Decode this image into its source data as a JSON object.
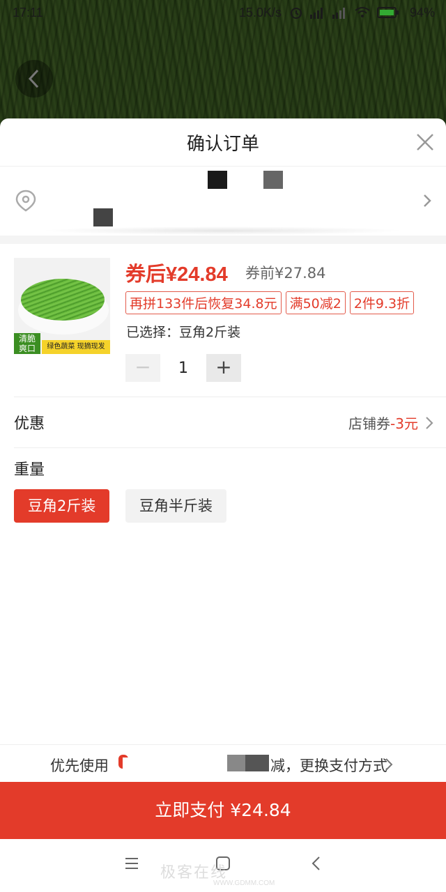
{
  "status_bar": {
    "time": "17:11",
    "speed": "15.0K/s",
    "battery": "94%"
  },
  "sheet": {
    "title": "确认订单"
  },
  "product": {
    "thumb_badge_left": "清脆\n爽口",
    "thumb_badge_right": "绿色蔬菜 现摘现发",
    "price_after": "券后¥24.84",
    "price_before": "券前¥27.84",
    "tags": [
      "再拼133件后恢复34.8元",
      "满50减2",
      "2件9.3折"
    ],
    "selected": "已选择：豆角2斤装",
    "quantity": "1",
    "minus_symbol": "−",
    "plus_symbol": "+"
  },
  "discount": {
    "label": "优惠",
    "value_prefix": "店铺券",
    "value_amount": "-3元"
  },
  "weight": {
    "label": "重量",
    "options": [
      "豆角2斤装",
      "豆角半斤装"
    ],
    "selected_index": 0
  },
  "pay_bar": {
    "left_text": "优先使用",
    "right_text": "减，更换支付方式"
  },
  "pay_button": {
    "label": "立即支付 ¥24.84"
  },
  "watermark": {
    "text": "极客在线",
    "url": "WWW.GDMM.COM"
  },
  "colors": {
    "accent": "#e33b2a",
    "divider": "#f4f4f4"
  },
  "icons": {
    "back": "chevron-left-icon",
    "close": "close-icon",
    "location": "location-pin-icon",
    "chevron": "chevron-right-icon",
    "nav_menu": "menu-icon",
    "nav_home": "home-square-icon",
    "nav_back": "back-icon"
  }
}
